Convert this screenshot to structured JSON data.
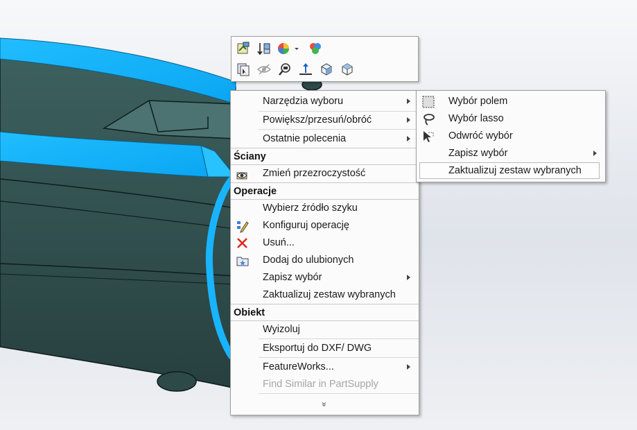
{
  "toolbar": {
    "row1": [
      "edit-sketch-icon",
      "sort-parts-icon",
      "appearance-icon",
      "dropdown-arrow-icon",
      "display-states-icon"
    ],
    "row2": [
      "select-other-icon",
      "hide-icon",
      "zoom-to-selection-icon",
      "normal-to-icon",
      "view-orientation-icon",
      "isometric-view-icon"
    ]
  },
  "menu": {
    "items_top": [
      {
        "label": "Narzędzia wyboru",
        "submenu": true
      },
      {
        "label": "Powiększ/przesuń/obróć",
        "submenu": true
      },
      {
        "label": "Ostatnie polecenia",
        "submenu": true
      }
    ],
    "section_faces": "Ściany",
    "faces_items": [
      {
        "label": "Zmień przezroczystość",
        "icon": "transparency-icon"
      }
    ],
    "section_operations": "Operacje",
    "operations_items": [
      {
        "label": "Wybierz źródło szyku"
      },
      {
        "label": "Konfiguruj operację",
        "icon": "configure-feature-icon"
      },
      {
        "label": "Usuń...",
        "icon": "delete-icon"
      },
      {
        "label": "Dodaj do ulubionych",
        "icon": "favorites-icon"
      },
      {
        "label": "Zapisz wybór",
        "submenu": true
      },
      {
        "label": "Zaktualizuj zestaw wybranych"
      }
    ],
    "section_object": "Obiekt",
    "object_items": [
      {
        "label": "Wyizoluj"
      },
      {
        "label": "Eksportuj do DXF/ DWG"
      },
      {
        "label": "FeatureWorks...",
        "submenu": true
      },
      {
        "label": "Find Similar in PartSupply",
        "disabled": true
      }
    ],
    "more_glyph": "»"
  },
  "submenu": {
    "items": [
      {
        "label": "Wybór polem",
        "icon": "box-select-icon"
      },
      {
        "label": "Wybór lasso",
        "icon": "lasso-select-icon"
      },
      {
        "label": "Odwróć wybór",
        "icon": "invert-selection-icon"
      },
      {
        "label": "Zapisz wybór",
        "submenu": true
      },
      {
        "label": "Zaktualizuj zestaw wybranych",
        "highlighted": true
      }
    ]
  },
  "colors": {
    "selection_face": "#19b4ff",
    "model_body": "#2f5352",
    "menu_bg": "#fbfbfb"
  }
}
